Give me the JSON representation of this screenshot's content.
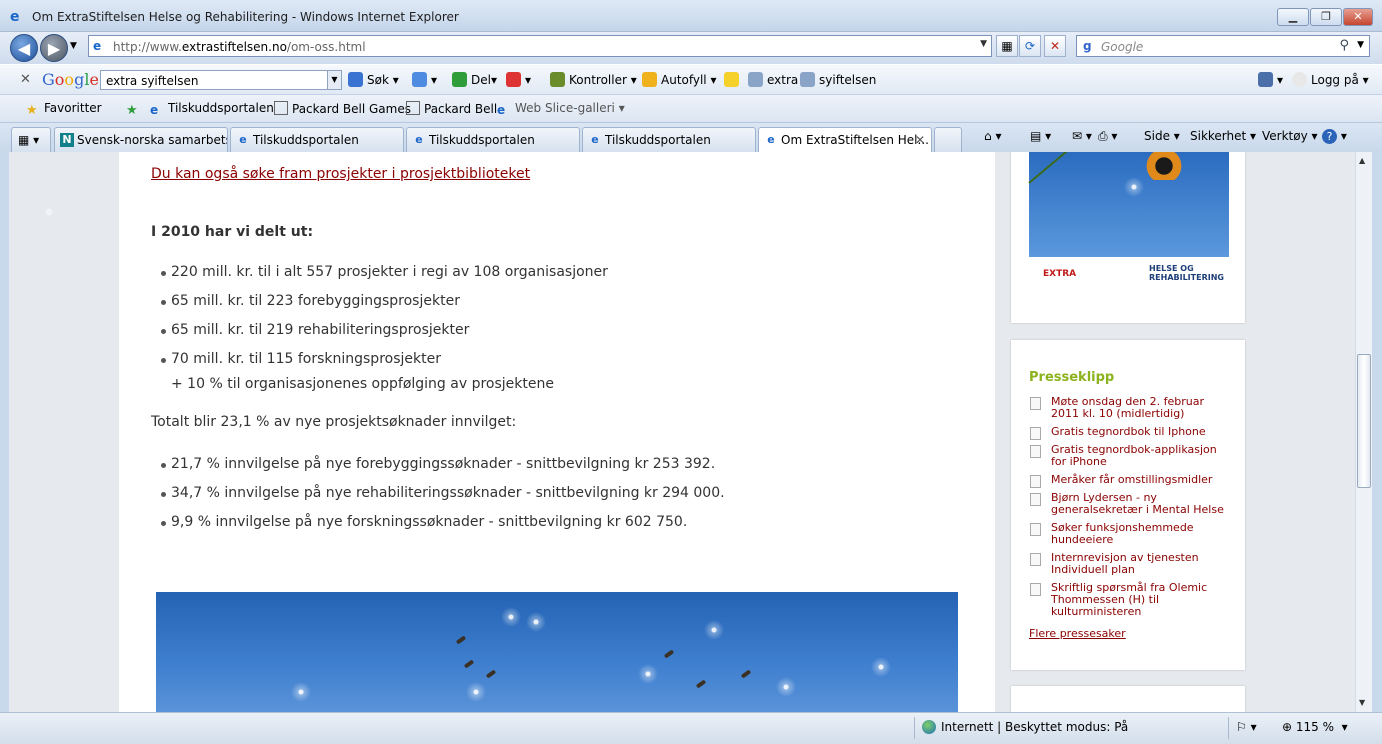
{
  "window": {
    "title": "Om ExtraStiftelsen Helse og Rehabilitering - Windows Internet Explorer"
  },
  "address": {
    "url_prefix": "http://www.",
    "url_domain": "extrastiftelsen.no",
    "url_path": "/om-oss.html"
  },
  "search": {
    "placeholder": "Google"
  },
  "google_toolbar": {
    "logo": "Google",
    "query": "extra syiftelsen",
    "items": [
      "Søk",
      "Del",
      "Kontroller",
      "Autofyll",
      "extra",
      "syiftelsen",
      "Logg på"
    ]
  },
  "favorites": {
    "label": "Favoritter",
    "items": [
      "Tilskuddsportalen",
      "Packard Bell Games",
      "Packard Bell",
      "Web Slice-galleri"
    ]
  },
  "tabs": [
    {
      "label": "Svensk-norska samarbetsf..."
    },
    {
      "label": "Tilskuddsportalen"
    },
    {
      "label": "Tilskuddsportalen"
    },
    {
      "label": "Tilskuddsportalen"
    },
    {
      "label": "Om ExtraStiftelsen Hel..."
    }
  ],
  "commands": [
    "Side",
    "Sikkerhet",
    "Verktøy"
  ],
  "main": {
    "link": "Du kan også søke fram prosjekter i prosjektbiblioteket",
    "heading": "I 2010 har vi delt ut:",
    "list1": [
      "220 mill. kr. til i alt 557 prosjekter i regi av 108 organisasjoner",
      "65 mill. kr. til 223 forebyggingsprosjekter",
      "65 mill. kr. til 219 rehabiliteringsprosjekter",
      "70 mill. kr. til 115 forskningsprosjekter"
    ],
    "extra_line": "+ 10 % til organisasjonenes oppfølging av prosjektene",
    "total": "Totalt blir 23,1 % av nye prosjektsøknader innvilget:",
    "list2": [
      "21,7 % innvilgelse på nye forebyggingssøknader - snittbevilgning kr 253 392.",
      "34,7 % innvilgelse på nye rehabiliteringssøknader - snittbevilgning kr 294 000.",
      "9,9 % innvilgelse på nye forskningssøknader - snittbevilgning kr 602 750."
    ]
  },
  "sidebar": {
    "logo_extra": "EXTRA",
    "logo_helse": "HELSE OG REHABILITERING",
    "press_title": "Presseklipp",
    "press_items": [
      "Møte onsdag den 2. februar 2011 kl. 10 (midlertidig)",
      "Gratis tegnordbok til Iphone",
      "Gratis tegnordbok-applikasjon for iPhone",
      "Meråker får omstillingsmidler",
      "Bjørn Lydersen - ny generalsekretær i Mental Helse",
      "Søker funksjonshemmede hundeeiere",
      "Internrevisjon av tjenesten Individuell plan",
      "Skriftlig spørsmål fra Olemic Thommessen (H) til kulturministeren"
    ],
    "more": "Flere pressesaker"
  },
  "status": {
    "zone": "Internett | Beskyttet modus: På",
    "zoom": "115 %"
  }
}
